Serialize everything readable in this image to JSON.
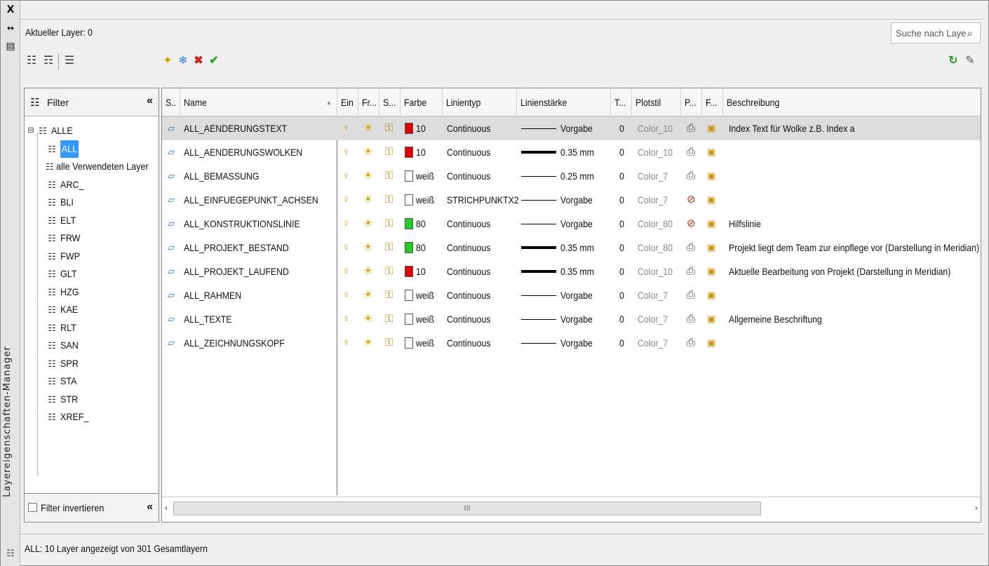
{
  "window": {
    "vertical_title": "Layereigenschaften-Manager",
    "close_glyph": "X",
    "pin_glyph": "↔",
    "props_glyph": "▤"
  },
  "header": {
    "current_layer": "Aktueller Layer: 0",
    "search_placeholder": "Suche nach Layer"
  },
  "toolbar": {
    "left_icons": [
      "new-property-filter-icon",
      "new-group-filter-icon",
      "layer-states-manager-icon"
    ],
    "mid_icons": [
      "new-layer-icon",
      "new-layer-vp-frozen-icon",
      "delete-layer-icon",
      "set-current-icon"
    ],
    "right_icons": [
      "refresh-icon",
      "settings-icon"
    ]
  },
  "filter_panel": {
    "title": "Filter",
    "root": "ALLE",
    "items": [
      "ALL",
      "alle Verwendeten Layer",
      "ARC_",
      "BLI",
      "ELT",
      "FRW",
      "FWP",
      "GLT",
      "HZG",
      "KAE",
      "RLT",
      "SAN",
      "SPR",
      "STA",
      "STR",
      "XREF_"
    ],
    "selected": "ALL",
    "invert_label": "Filter invertieren"
  },
  "grid": {
    "columns": [
      "S..",
      "Name",
      "Ein",
      "Fr...",
      "S...",
      "Farbe",
      "Linientyp",
      "Linienstärke",
      "T...",
      "Plotstil",
      "P...",
      "F...",
      "Beschreibung"
    ],
    "rows": [
      {
        "name": "ALL_AENDERUNGSTEXT",
        "color_hex": "#e00000",
        "color": "10",
        "linetype": "Continuous",
        "lineweight": "Vorgabe",
        "thick": false,
        "transparency": "0",
        "plotstyle": "Color_10",
        "plot": true,
        "description": "Index Text für Wolke z.B. Index a"
      },
      {
        "name": "ALL_AENDERUNGSWOLKEN",
        "color_hex": "#e00000",
        "color": "10",
        "linetype": "Continuous",
        "lineweight": "0.35 mm",
        "thick": true,
        "transparency": "0",
        "plotstyle": "Color_10",
        "plot": true,
        "description": ""
      },
      {
        "name": "ALL_BEMASSUNG",
        "color_hex": "#ffffff",
        "color": "weiß",
        "linetype": "Continuous",
        "lineweight": "0.25 mm",
        "thick": false,
        "transparency": "0",
        "plotstyle": "Color_7",
        "plot": true,
        "description": ""
      },
      {
        "name": "ALL_EINFUEGEPUNKT_ACHSEN",
        "color_hex": "#ffffff",
        "color": "weiß",
        "linetype": "STRICHPUNKTX2",
        "lineweight": "Vorgabe",
        "thick": false,
        "transparency": "0",
        "plotstyle": "Color_7",
        "plot": false,
        "description": ""
      },
      {
        "name": "ALL_KONSTRUKTIONSLINIE",
        "color_hex": "#22cc22",
        "color": "80",
        "linetype": "Continuous",
        "lineweight": "Vorgabe",
        "thick": false,
        "transparency": "0",
        "plotstyle": "Color_80",
        "plot": false,
        "description": "Hilfslinie"
      },
      {
        "name": "ALL_PROJEKT_BESTAND",
        "color_hex": "#22cc22",
        "color": "80",
        "linetype": "Continuous",
        "lineweight": "0.35 mm",
        "thick": true,
        "transparency": "0",
        "plotstyle": "Color_80",
        "plot": true,
        "description": "Projekt liegt dem Team zur einpflege vor (Darstellung in Meridian)"
      },
      {
        "name": "ALL_PROJEKT_LAUFEND",
        "color_hex": "#e00000",
        "color": "10",
        "linetype": "Continuous",
        "lineweight": "0.35 mm",
        "thick": true,
        "transparency": "0",
        "plotstyle": "Color_10",
        "plot": true,
        "description": "Aktuelle Bearbeitung von Projekt (Darstellung in Meridian)"
      },
      {
        "name": "ALL_RAHMEN",
        "color_hex": "#ffffff",
        "color": "weiß",
        "linetype": "Continuous",
        "lineweight": "Vorgabe",
        "thick": false,
        "transparency": "0",
        "plotstyle": "Color_7",
        "plot": true,
        "description": ""
      },
      {
        "name": "ALL_TEXTE",
        "color_hex": "#ffffff",
        "color": "weiß",
        "linetype": "Continuous",
        "lineweight": "Vorgabe",
        "thick": false,
        "transparency": "0",
        "plotstyle": "Color_7",
        "plot": true,
        "description": "Allgemeine Beschriftung"
      },
      {
        "name": "ALL_ZEICHNUNGSKOPF",
        "color_hex": "#ffffff",
        "color": "weiß",
        "linetype": "Continuous",
        "lineweight": "Vorgabe",
        "thick": false,
        "transparency": "0",
        "plotstyle": "Color_7",
        "plot": true,
        "description": ""
      }
    ],
    "scroll_grip": "III"
  },
  "status": {
    "text": "ALL: 10 Layer angezeigt von 301 Gesamtlayern"
  }
}
